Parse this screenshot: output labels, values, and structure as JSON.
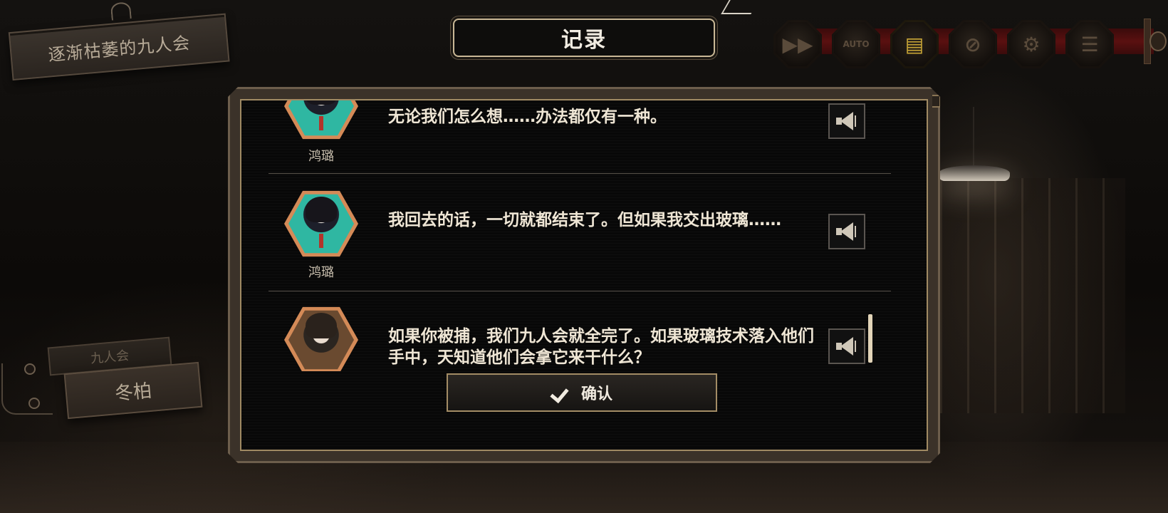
{
  "chapter": {
    "title": "逐渐枯萎的九人会"
  },
  "header": {
    "title": "记录"
  },
  "toolbar": {
    "buttons": [
      {
        "name": "fast-forward",
        "glyph": "▶▶",
        "active": false
      },
      {
        "name": "auto",
        "glyph": "AUTO",
        "active": false
      },
      {
        "name": "log",
        "glyph": "▤",
        "active": true
      },
      {
        "name": "skip-disabled",
        "glyph": "⊘",
        "active": false
      },
      {
        "name": "settings",
        "glyph": "⚙",
        "active": false
      },
      {
        "name": "menu",
        "glyph": "☰",
        "active": false
      }
    ]
  },
  "side_tags": {
    "group": "九人会",
    "character": "冬柏"
  },
  "log": {
    "entries": [
      {
        "speaker": "鸿璐",
        "text": "无论我们怎么想……办法都仅有一种。",
        "portrait": "teal"
      },
      {
        "speaker": "鸿璐",
        "text": "我回去的话，一切就都结束了。但如果我交出玻璃……",
        "portrait": "teal"
      },
      {
        "speaker": "",
        "text": "如果你被捕，我们九人会就全完了。如果玻璃技术落入他们手中，天知道他们会拿它来干什么？",
        "portrait": "brown"
      }
    ],
    "confirm_label": "确认"
  },
  "colors": {
    "accent": "#c9a636",
    "frame": "#a08a63",
    "text": "#efe6d5",
    "rail": "#5a1010"
  }
}
